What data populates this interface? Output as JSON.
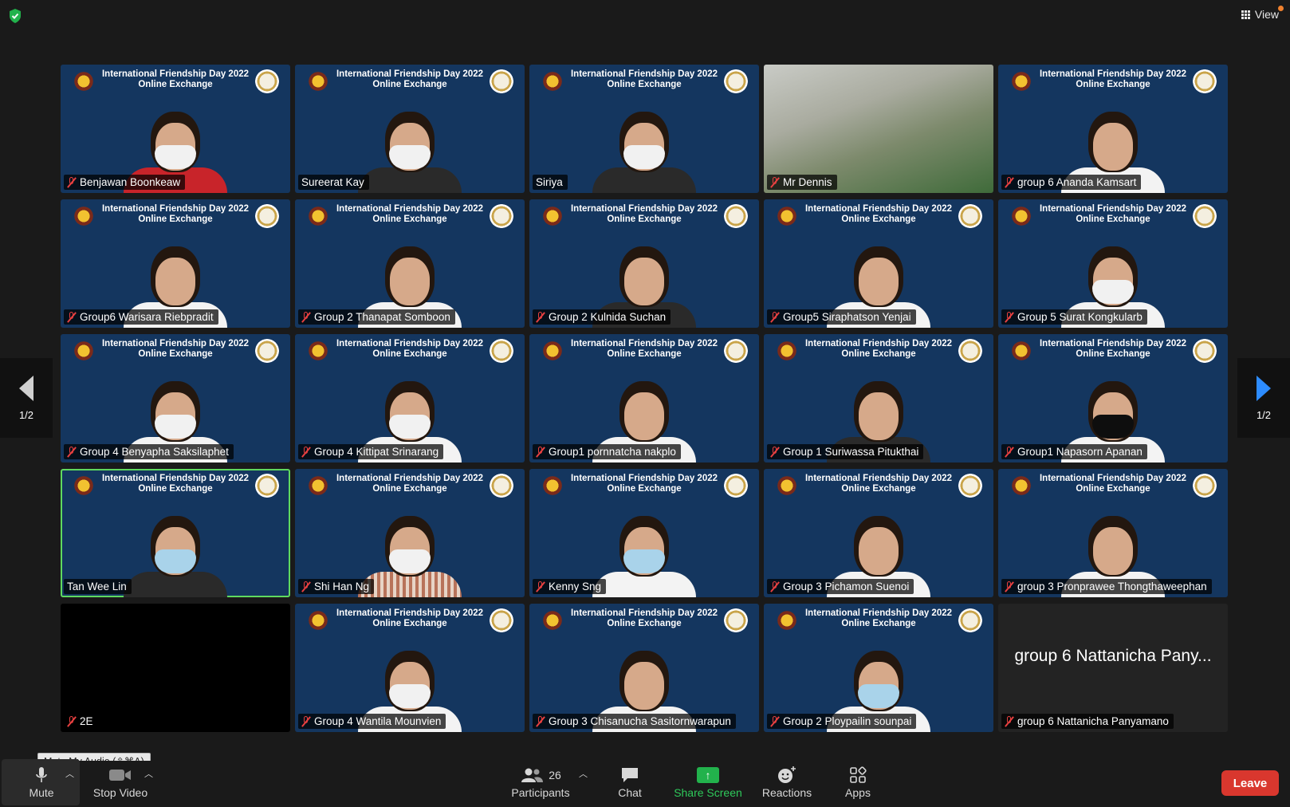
{
  "banner": {
    "line1": "International Friendship Day 2022",
    "line2": "Online Exchange"
  },
  "top": {
    "view_label": "View"
  },
  "pager": {
    "left": "1/2",
    "right": "1/2"
  },
  "participants": [
    {
      "name": "Benjawan Boonkeaw",
      "muted": true,
      "bg": "banner",
      "body": "red",
      "mask": "white"
    },
    {
      "name": "Sureerat Kay",
      "muted": false,
      "bg": "banner",
      "body": "dark",
      "mask": "white"
    },
    {
      "name": "Siriya",
      "muted": false,
      "bg": "banner",
      "body": "dark",
      "mask": "white"
    },
    {
      "name": "Mr Dennis",
      "muted": true,
      "bg": "photo"
    },
    {
      "name": "group 6 Ananda Kamsart",
      "muted": true,
      "bg": "banner",
      "body": "white",
      "mask": ""
    },
    {
      "name": "Group6 Warisara Riebpradit",
      "muted": true,
      "bg": "banner",
      "body": "white",
      "mask": ""
    },
    {
      "name": "Group 2 Thanapat Somboon",
      "muted": true,
      "bg": "banner",
      "body": "white",
      "mask": ""
    },
    {
      "name": "Group 2 Kulnida Suchan",
      "muted": true,
      "bg": "banner",
      "body": "dark",
      "mask": ""
    },
    {
      "name": "Group5 Siraphatson Yenjai",
      "muted": true,
      "bg": "banner",
      "body": "white",
      "mask": ""
    },
    {
      "name": "Group 5 Surat Kongkularb",
      "muted": true,
      "bg": "banner",
      "body": "white",
      "mask": "white"
    },
    {
      "name": "Group 4 Benyapha Saksilaphet",
      "muted": true,
      "bg": "banner",
      "body": "white",
      "mask": "white"
    },
    {
      "name": "Group 4 Kittipat Srinarang",
      "muted": true,
      "bg": "banner",
      "body": "white",
      "mask": "white"
    },
    {
      "name": "Group1 pornnatcha nakplo",
      "muted": true,
      "bg": "banner",
      "body": "white",
      "mask": ""
    },
    {
      "name": "Group 1 Suriwassa Pitukthai",
      "muted": true,
      "bg": "banner",
      "body": "dark",
      "mask": ""
    },
    {
      "name": "Group1 Napasorn Apanan",
      "muted": true,
      "bg": "banner",
      "body": "white",
      "mask": "black"
    },
    {
      "name": "Tan Wee Lin",
      "muted": false,
      "bg": "banner",
      "body": "dark",
      "mask": "blue",
      "active": true
    },
    {
      "name": "Shi Han Ng",
      "muted": true,
      "bg": "banner",
      "body": "stripe",
      "mask": "white"
    },
    {
      "name": "Kenny Sng",
      "muted": true,
      "bg": "banner",
      "body": "white",
      "mask": "blue"
    },
    {
      "name": "Group 3 Pichamon Suenoi",
      "muted": true,
      "bg": "banner",
      "body": "white",
      "mask": ""
    },
    {
      "name": "group 3 Pronprawee Thongthaweephan",
      "muted": true,
      "bg": "banner",
      "body": "white",
      "mask": ""
    },
    {
      "name": "2E",
      "muted": true,
      "bg": "dark"
    },
    {
      "name": "Group 4 Wantila Mounvien",
      "muted": true,
      "bg": "banner",
      "body": "white",
      "mask": "white"
    },
    {
      "name": "Group 3 Chisanucha Sasitornwarapun",
      "muted": true,
      "bg": "banner",
      "body": "white",
      "mask": ""
    },
    {
      "name": "Group 2 Ploypailin sounpai",
      "muted": true,
      "bg": "banner",
      "body": "white",
      "mask": "blue"
    },
    {
      "name": "group 6 Nattanicha Panyamano",
      "muted": true,
      "bg": "plain",
      "display": "group 6 Nattanicha Pany..."
    }
  ],
  "toolbar": {
    "tooltip": "Mute My Audio (⇧⌘A)",
    "mute": "Mute",
    "stop_video": "Stop Video",
    "participants": "Participants",
    "participants_count": "26",
    "chat": "Chat",
    "share_screen": "Share Screen",
    "reactions": "Reactions",
    "apps": "Apps",
    "leave": "Leave"
  },
  "colors": {
    "accent_green": "#22b24c",
    "leave_red": "#d9372e",
    "active_border": "#5fd95f",
    "pager_arrow": "#2d8cff"
  }
}
